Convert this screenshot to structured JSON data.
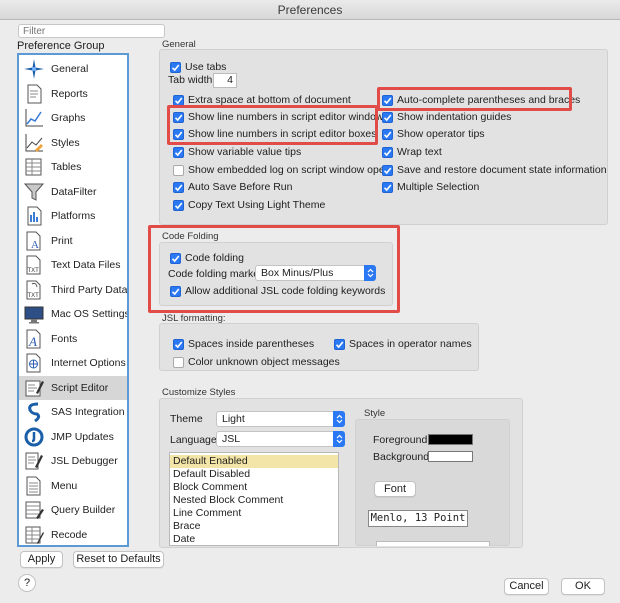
{
  "window": {
    "title": "Preferences"
  },
  "sidebar": {
    "filter_placeholder": "Filter",
    "group_label": "Preference Group",
    "items": [
      {
        "label": "General",
        "icon": "general-icon"
      },
      {
        "label": "Reports",
        "icon": "reports-icon"
      },
      {
        "label": "Graphs",
        "icon": "graphs-icon"
      },
      {
        "label": "Styles",
        "icon": "styles-icon"
      },
      {
        "label": "Tables",
        "icon": "tables-icon"
      },
      {
        "label": "DataFilter",
        "icon": "datafilter-icon"
      },
      {
        "label": "Platforms",
        "icon": "platforms-icon"
      },
      {
        "label": "Print",
        "icon": "print-icon"
      },
      {
        "label": "Text Data Files",
        "icon": "text-data-files-icon"
      },
      {
        "label": "Third Party Data",
        "icon": "third-party-data-icon"
      },
      {
        "label": "Mac OS Settings",
        "icon": "mac-os-settings-icon"
      },
      {
        "label": "Fonts",
        "icon": "fonts-icon"
      },
      {
        "label": "Internet Options",
        "icon": "internet-options-icon"
      },
      {
        "label": "Script Editor",
        "icon": "script-editor-icon",
        "selected": true
      },
      {
        "label": "SAS Integration",
        "icon": "sas-integration-icon"
      },
      {
        "label": "JMP Updates",
        "icon": "jmp-updates-icon"
      },
      {
        "label": "JSL Debugger",
        "icon": "jsl-debugger-icon"
      },
      {
        "label": "Menu",
        "icon": "menu-icon"
      },
      {
        "label": "Query Builder",
        "icon": "query-builder-icon"
      },
      {
        "label": "Recode",
        "icon": "recode-icon"
      }
    ]
  },
  "general": {
    "title": "General",
    "use_tabs": "Use tabs",
    "tab_width_label": "Tab width:",
    "tab_width_value": "4",
    "left": [
      {
        "label": "Extra space at bottom of document",
        "checked": true
      },
      {
        "label": "Show line numbers in script editor windows",
        "checked": true
      },
      {
        "label": "Show line numbers in script editor boxes",
        "checked": true
      },
      {
        "label": "Show variable value tips",
        "checked": true
      },
      {
        "label": "Show embedded log on script window open",
        "checked": false
      },
      {
        "label": "Auto Save Before Run",
        "checked": true
      },
      {
        "label": "Copy Text Using Light Theme",
        "checked": true
      }
    ],
    "right": [
      {
        "label": "Auto-complete parentheses and braces",
        "checked": true
      },
      {
        "label": "Show indentation guides",
        "checked": true
      },
      {
        "label": "Show operator tips",
        "checked": true
      },
      {
        "label": "Wrap text",
        "checked": true
      },
      {
        "label": "Save and restore document state information",
        "checked": true
      },
      {
        "label": "Multiple Selection",
        "checked": true
      }
    ]
  },
  "code_folding": {
    "title": "Code Folding",
    "code_folding": "Code folding",
    "marker_label": "Code folding marker",
    "marker_value": "Box Minus/Plus",
    "allow_keywords": "Allow additional JSL code folding keywords"
  },
  "jsl_formatting": {
    "title": "JSL formatting:",
    "spaces_parens": {
      "label": "Spaces inside parentheses",
      "checked": true
    },
    "spaces_operators": {
      "label": "Spaces in operator names",
      "checked": true
    },
    "color_unknown": {
      "label": "Color unknown object messages",
      "checked": false
    }
  },
  "customize_styles": {
    "title": "Customize Styles",
    "theme_label": "Theme",
    "theme_value": "Light",
    "language_label": "Language",
    "language_value": "JSL",
    "list": [
      "Default Enabled",
      "Default Disabled",
      "Block Comment",
      "Nested Block Comment",
      "Line Comment",
      "Brace",
      "Date"
    ],
    "style_title": "Style",
    "foreground_label": "Foreground",
    "foreground_color": "#000000",
    "background_label": "Background",
    "background_color": "#ffffff",
    "font_button": "Font",
    "font_value": "Menlo, 13 Point"
  },
  "footer": {
    "apply": "Apply",
    "reset": "Reset to Defaults",
    "help": "?",
    "cancel": "Cancel",
    "ok": "OK"
  },
  "colors": {
    "accent": "#2a78f4",
    "highlight": "#e24c48",
    "selection": "#d6d6d6",
    "list_selection": "#f3e5a7"
  }
}
